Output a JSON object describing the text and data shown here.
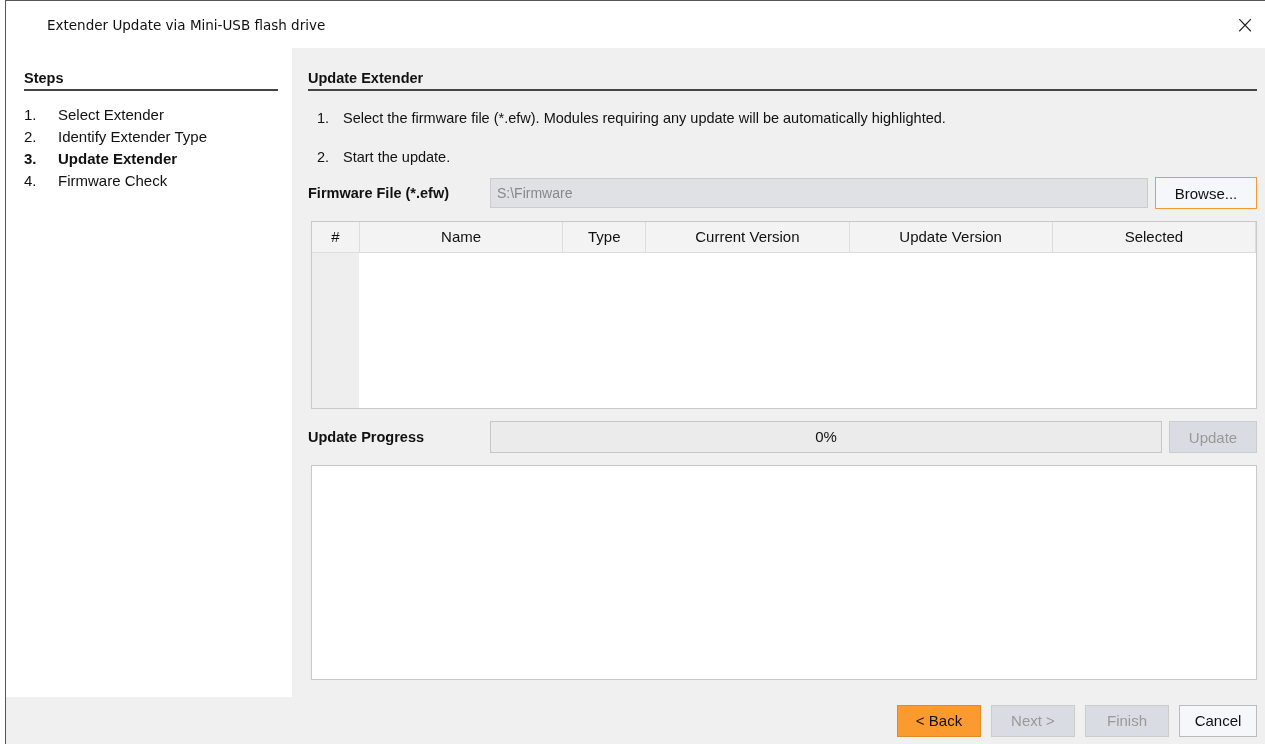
{
  "window": {
    "title": "Extender Update via Mini-USB flash drive",
    "close": "×"
  },
  "steps": {
    "heading": "Steps",
    "items": [
      {
        "number": "1.",
        "label": "Select Extender",
        "selected": false
      },
      {
        "number": "2.",
        "label": "Identify Extender Type",
        "selected": false
      },
      {
        "number": "3.",
        "label": "Update Extender",
        "selected": true
      },
      {
        "number": "4.",
        "label": "Firmware Check",
        "selected": false
      }
    ]
  },
  "main": {
    "heading": "Update Extender",
    "instructions": [
      {
        "number": "1.",
        "text": "Select the firmware file (*.efw). Modules requiring any update will be automatically highlighted."
      },
      {
        "number": "2.",
        "text": "Start the update."
      }
    ],
    "firmware_file": {
      "label": "Firmware File (*.efw)",
      "value": "S:\\Firmware",
      "disabled": true,
      "button": "Browse..."
    },
    "table": {
      "columns": [
        "#",
        "Name",
        "Type",
        "Current Version",
        "Update Version",
        "Selected"
      ]
    },
    "progress": {
      "label": "Update Progress",
      "level": 0,
      "reading": "0%",
      "button": {
        "label": "Update",
        "disabled": true
      }
    }
  },
  "buttons": [
    {
      "label": "< Back",
      "disabled": false,
      "focused": true
    },
    {
      "label": "Next >",
      "disabled": true,
      "focused": false
    },
    {
      "label": "Finish",
      "disabled": true,
      "focused": false
    },
    {
      "label": "Cancel",
      "disabled": false,
      "focused": false
    }
  ]
}
